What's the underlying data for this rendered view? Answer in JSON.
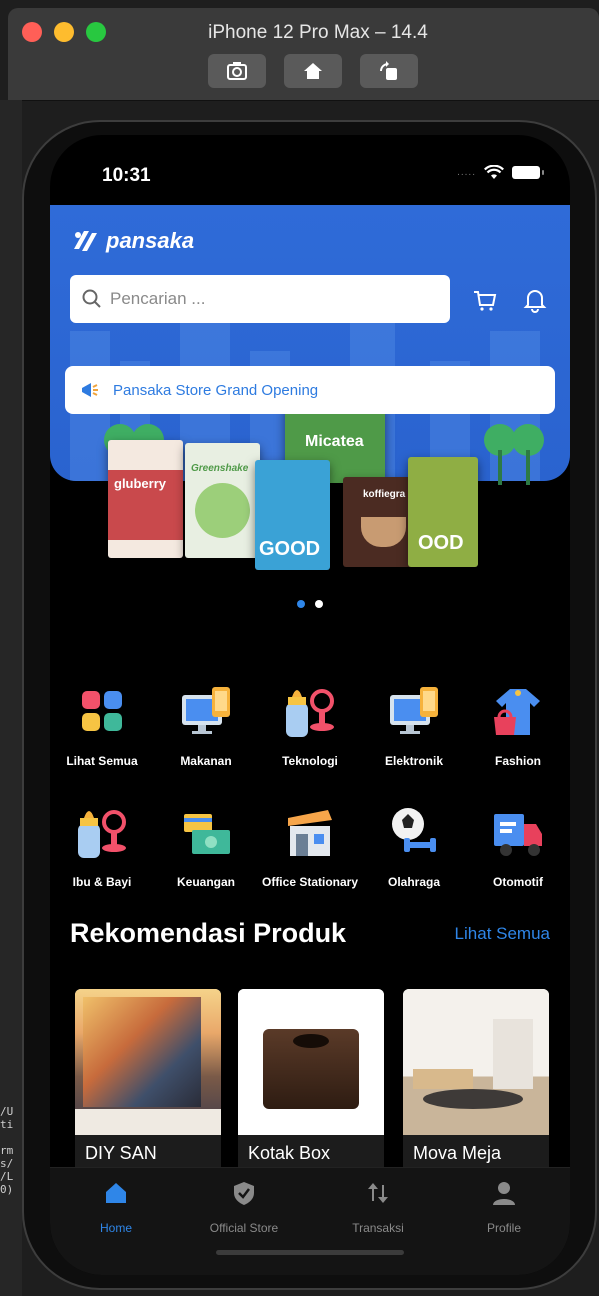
{
  "simulator": {
    "title": "iPhone 12 Pro Max – 14.4",
    "buttons": [
      "screenshot-icon",
      "home-icon",
      "rotate-icon"
    ],
    "terminal_lines": [
      "/U",
      "ti",
      "",
      "rm",
      "s/",
      "/L",
      "0)"
    ]
  },
  "status_bar": {
    "time": "10:31",
    "signal_dots": "....."
  },
  "header": {
    "brand": "pansaka",
    "search_placeholder": "Pencarian ...",
    "icons": [
      "cart-icon",
      "bell-icon"
    ],
    "promo_text": "Pansaka Store Grand Opening"
  },
  "banner": {
    "products": [
      {
        "name": "gluberry",
        "color": "#c9494c"
      },
      {
        "name": "Greenshake",
        "color": "#e8efe2"
      },
      {
        "name": "GOOD",
        "color": "#3aa2d6"
      },
      {
        "name": "Micatea",
        "color": "#4f9a48"
      },
      {
        "name": "koffiegra",
        "color": "#4b2b22"
      },
      {
        "name": "OOD",
        "color": "#8fae44"
      }
    ],
    "carousel_dots": 2,
    "active_dot": 0
  },
  "categories": [
    {
      "label": "Lihat Semua",
      "icon": "grid-icon"
    },
    {
      "label": "Makanan",
      "icon": "monitor-icon"
    },
    {
      "label": "Teknologi",
      "icon": "baby-bottle-icon"
    },
    {
      "label": "Elektronik",
      "icon": "monitor-icon"
    },
    {
      "label": "Fashion",
      "icon": "clothes-icon"
    },
    {
      "label": "Ibu & Bayi",
      "icon": "baby-bottle-icon"
    },
    {
      "label": "Keuangan",
      "icon": "money-icon"
    },
    {
      "label": "Office Stationary",
      "icon": "store-icon"
    },
    {
      "label": "Olahraga",
      "icon": "sports-icon"
    },
    {
      "label": "Otomotif",
      "icon": "truck-icon"
    }
  ],
  "recommendations": {
    "title": "Rekomendasi Produk",
    "see_all": "Lihat Semua",
    "items": [
      {
        "name": "DIY SAN",
        "image": "painting"
      },
      {
        "name": "Kotak Box",
        "image": "wooden-box"
      },
      {
        "name": "Mova Meja",
        "image": "room-table"
      }
    ]
  },
  "tabbar": {
    "items": [
      {
        "label": "Home",
        "icon": "home-icon",
        "active": true
      },
      {
        "label": "Official Store",
        "icon": "shield-icon",
        "active": false
      },
      {
        "label": "Transaksi",
        "icon": "transfer-icon",
        "active": false
      },
      {
        "label": "Profile",
        "icon": "user-icon",
        "active": false
      }
    ],
    "active_color": "#2f86e8",
    "inactive_color": "#8a8a8a"
  },
  "colors": {
    "brand_blue": "#2f6bd8",
    "accent": "#2f86e8"
  }
}
